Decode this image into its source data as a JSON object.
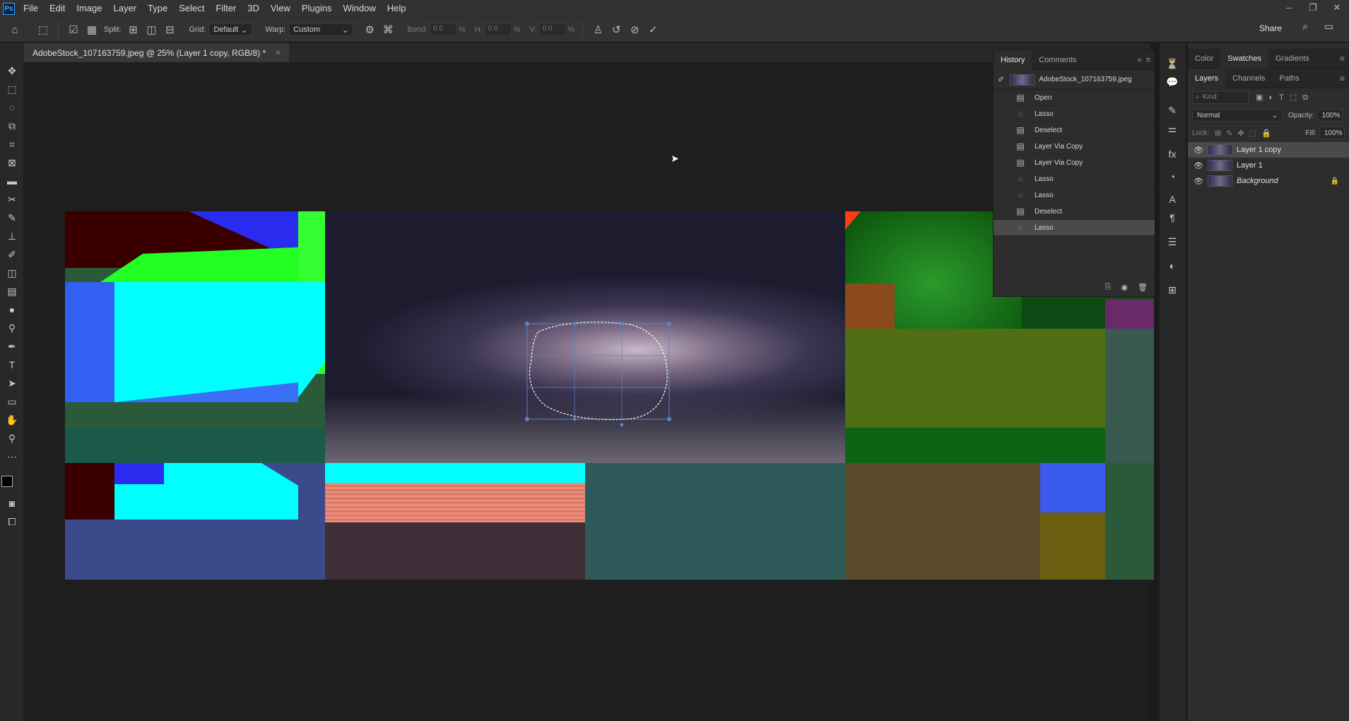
{
  "menubar": {
    "logo": "Ps",
    "items": [
      "File",
      "Edit",
      "Image",
      "Layer",
      "Type",
      "Select",
      "Filter",
      "3D",
      "View",
      "Plugins",
      "Window",
      "Help"
    ]
  },
  "options": {
    "split_label": "Split:",
    "grid_label": "Grid:",
    "grid_value": "Default",
    "warp_label": "Warp:",
    "warp_value": "Custom",
    "bend_label": "Bend:",
    "bend_value": "0.0",
    "h_label": "H:",
    "h_value": "0.0",
    "v_label": "V:",
    "v_value": "0.0",
    "percent": "%",
    "share": "Share"
  },
  "document": {
    "tab_title": "AdobeStock_107163759.jpeg @ 25% (Layer 1 copy, RGB/8) *",
    "close": "×"
  },
  "history": {
    "tabs": [
      "History",
      "Comments"
    ],
    "snapshot": "AdobeStock_107163759.jpeg",
    "items": [
      {
        "label": "Open",
        "icon": "doc-icon"
      },
      {
        "label": "Lasso",
        "icon": "lasso-icon"
      },
      {
        "label": "Deselect",
        "icon": "doc-icon"
      },
      {
        "label": "Layer Via Copy",
        "icon": "doc-icon"
      },
      {
        "label": "Layer Via Copy",
        "icon": "doc-icon"
      },
      {
        "label": "Lasso",
        "icon": "lasso-icon"
      },
      {
        "label": "Lasso",
        "icon": "lasso-icon"
      },
      {
        "label": "Deselect",
        "icon": "doc-icon"
      },
      {
        "label": "Lasso",
        "icon": "lasso-icon"
      }
    ],
    "selected_index": 8
  },
  "color_panel": {
    "tabs": [
      "Color",
      "Swatches",
      "Gradients"
    ],
    "active": "Swatches"
  },
  "layers_panel": {
    "tabs": [
      "Layers",
      "Channels",
      "Paths"
    ],
    "filter_placeholder": "Kind",
    "blend_mode": "Normal",
    "opacity_label": "Opacity:",
    "opacity_value": "100%",
    "lock_label": "Lock:",
    "fill_label": "Fill:",
    "fill_value": "100%",
    "layers": [
      {
        "name": "Layer 1 copy",
        "selected": true,
        "locked": false
      },
      {
        "name": "Layer 1",
        "selected": false,
        "locked": false
      },
      {
        "name": "Background",
        "selected": false,
        "locked": true
      }
    ]
  },
  "colors": {
    "accent": "#31a8ff",
    "panel": "#2d2d2d",
    "selection": "#4a4a4a"
  }
}
